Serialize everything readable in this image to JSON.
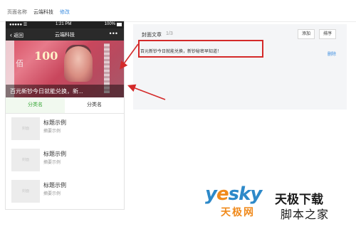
{
  "page_name": {
    "label": "页面名称",
    "value": "云端科技",
    "edit": "修改"
  },
  "phone": {
    "status": {
      "carrier": "●●●●● ☰",
      "time": "1:21 PM",
      "battery": "100%"
    },
    "nav": {
      "back": "返回",
      "title": "云端科技",
      "more": "•••"
    },
    "cover": {
      "caption": "百元新钞今日就能兑换，新...",
      "banknote_text": "100",
      "banknote_glyph": "佰"
    },
    "tabs": [
      {
        "label": "分类名",
        "active": true
      },
      {
        "label": "分类名",
        "active": false
      }
    ],
    "articles": [
      {
        "thumb": "封面",
        "title": "标题示例",
        "summary": "摘要示例"
      },
      {
        "thumb": "封面",
        "title": "标题示例",
        "summary": "摘要示例"
      },
      {
        "thumb": "封面",
        "title": "标题示例",
        "summary": "摘要示例"
      }
    ]
  },
  "panel": {
    "cover_label": "封面文章",
    "count": "1/3",
    "add_label": "添加",
    "sort_label": "排序",
    "article_title": "百元新钞今日就能兑换，新钞秘密早知道！",
    "delete_label": "删除"
  },
  "watermark": {
    "brand": "yesky",
    "cn_name": "天极网",
    "site": "天极下载",
    "site2": "脚本之家"
  },
  "colors": {
    "accent_green": "#3aa83a",
    "link_blue": "#3b8de0",
    "annotation_red": "#d42a2a"
  }
}
